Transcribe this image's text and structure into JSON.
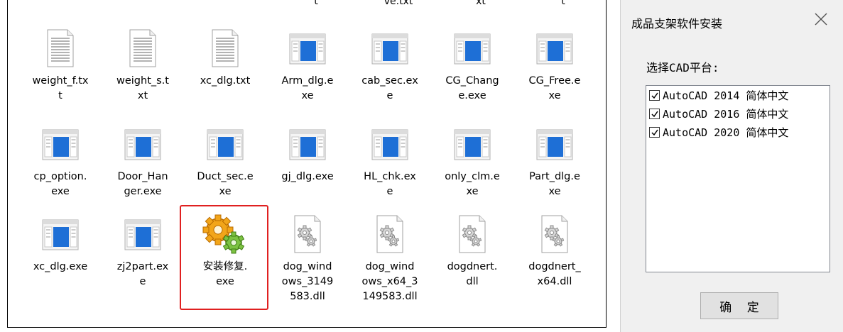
{
  "explorer": {
    "cut_top_labels": [
      "t",
      "ve.txt",
      "xt",
      "t"
    ],
    "files": [
      {
        "name": "weight_f.tx\nt",
        "icon": "text-file-icon"
      },
      {
        "name": "weight_s.t\nxt",
        "icon": "text-file-icon"
      },
      {
        "name": "xc_dlg.txt",
        "icon": "text-file-icon"
      },
      {
        "name": "Arm_dlg.e\nxe",
        "icon": "exe-window-icon"
      },
      {
        "name": "cab_sec.ex\ne",
        "icon": "exe-window-icon"
      },
      {
        "name": "CG_Chang\ne.exe",
        "icon": "exe-window-icon"
      },
      {
        "name": "CG_Free.e\nxe",
        "icon": "exe-window-icon"
      },
      {
        "name": "cp_option.\nexe",
        "icon": "exe-window-icon"
      },
      {
        "name": "Door_Han\nger.exe",
        "icon": "exe-window-icon"
      },
      {
        "name": "Duct_sec.e\nxe",
        "icon": "exe-window-icon"
      },
      {
        "name": "gj_dlg.exe",
        "icon": "exe-window-icon"
      },
      {
        "name": "HL_chk.ex\ne",
        "icon": "exe-window-icon"
      },
      {
        "name": "only_clm.e\nxe",
        "icon": "exe-window-icon"
      },
      {
        "name": "Part_dlg.e\nxe",
        "icon": "exe-window-icon"
      },
      {
        "name": "xc_dlg.exe",
        "icon": "exe-window-icon"
      },
      {
        "name": "zj2part.ex\ne",
        "icon": "exe-window-icon"
      },
      {
        "name": "安装修复.\nexe",
        "icon": "gears-setup-icon"
      },
      {
        "name": "dog_wind\nows_3149\n583.dll",
        "icon": "dll-gear-icon"
      },
      {
        "name": "dog_wind\nows_x64_3\n149583.dll",
        "icon": "dll-gear-icon"
      },
      {
        "name": "dogdnert.\ndll",
        "icon": "dll-gear-icon"
      },
      {
        "name": "dogdnert_\nx64.dll",
        "icon": "dll-gear-icon"
      }
    ],
    "highlight_color": "#e02020"
  },
  "dialog": {
    "title": "成品支架软件安装",
    "close_icon": "close-icon",
    "platform_label": "选择CAD平台:",
    "options": [
      {
        "label": "AutoCAD 2014 简体中文",
        "checked": true
      },
      {
        "label": "AutoCAD 2016 简体中文",
        "checked": true
      },
      {
        "label": "AutoCAD 2020 简体中文",
        "checked": true
      }
    ],
    "ok_label": "确 定"
  }
}
